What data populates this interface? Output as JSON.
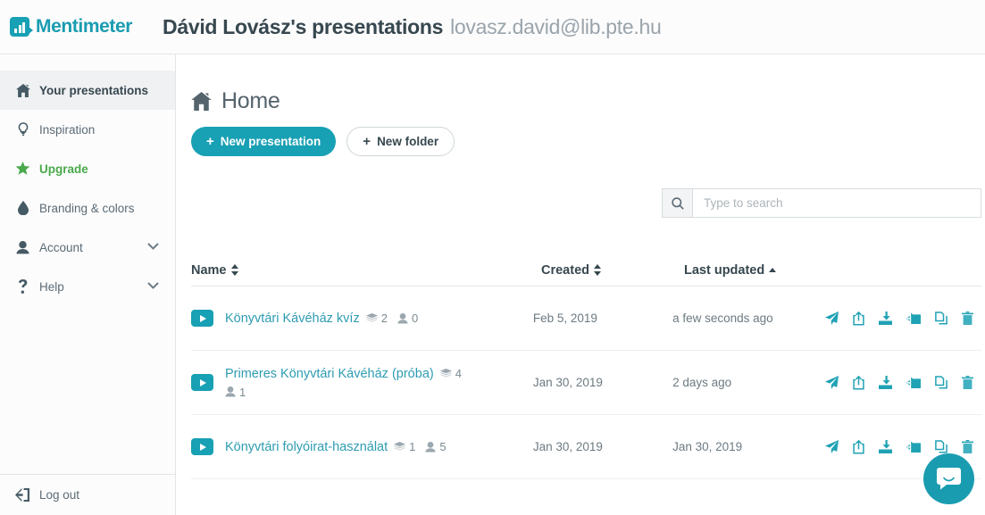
{
  "header": {
    "brand_name": "Mentimeter",
    "brand_icon": "bar-chart-logo-icon",
    "account_title": "Dávid Lovász's presentations",
    "account_email": "lovasz.david@lib.pte.hu"
  },
  "sidebar": {
    "items": [
      {
        "label": "Your presentations",
        "icon": "home-icon",
        "active": true
      },
      {
        "label": "Inspiration",
        "icon": "lightbulb-icon",
        "active": false
      },
      {
        "label": "Upgrade",
        "icon": "star-icon",
        "active": false
      },
      {
        "label": "Branding & colors",
        "icon": "droplet-icon",
        "active": false
      },
      {
        "label": "Account",
        "icon": "user-icon",
        "active": false,
        "chevron": "chevron-down-icon"
      },
      {
        "label": "Help",
        "icon": "question-mark-icon",
        "active": false,
        "chevron": "chevron-down-icon"
      }
    ],
    "logout": {
      "label": "Log out",
      "icon": "sign-out-icon"
    }
  },
  "main": {
    "page_title": "Home",
    "page_title_icon": "home-icon",
    "new_presentation_label": "New presentation",
    "new_folder_label": "New folder",
    "plus": "+",
    "search": {
      "placeholder": "Type to search",
      "value": "",
      "icon": "search-icon"
    },
    "table": {
      "columns": {
        "name": "Name",
        "created": "Created",
        "updated": "Last updated"
      },
      "sort": {
        "name": "both",
        "created": "both",
        "updated": "asc"
      },
      "rows": [
        {
          "name": "Könyvtári Kávéház kvíz",
          "slides": "2",
          "participants": "0",
          "created": "Feb 5, 2019",
          "updated": "a few seconds ago"
        },
        {
          "name": "Primeres Könyvtári Kávéház (próba)",
          "slides": "4",
          "participants": "1",
          "created": "Jan 30, 2019",
          "updated": "2 days ago"
        },
        {
          "name": "Könyvtári folyóirat-használat",
          "slides": "1",
          "participants": "5",
          "created": "Jan 30, 2019",
          "updated": "Jan 30, 2019"
        }
      ],
      "row_actions": [
        "present-icon",
        "share-icon",
        "download-icon",
        "move-to-folder-icon",
        "duplicate-icon",
        "delete-icon"
      ]
    }
  },
  "chat_widget": {
    "icon": "chat-bubble-icon"
  },
  "colors": {
    "brand_teal": "#18a0b4",
    "link_teal": "#2e9cb2",
    "upgrade_green": "#4aa94a",
    "text_dark": "#37474f",
    "text_muted": "#6c7a82"
  }
}
